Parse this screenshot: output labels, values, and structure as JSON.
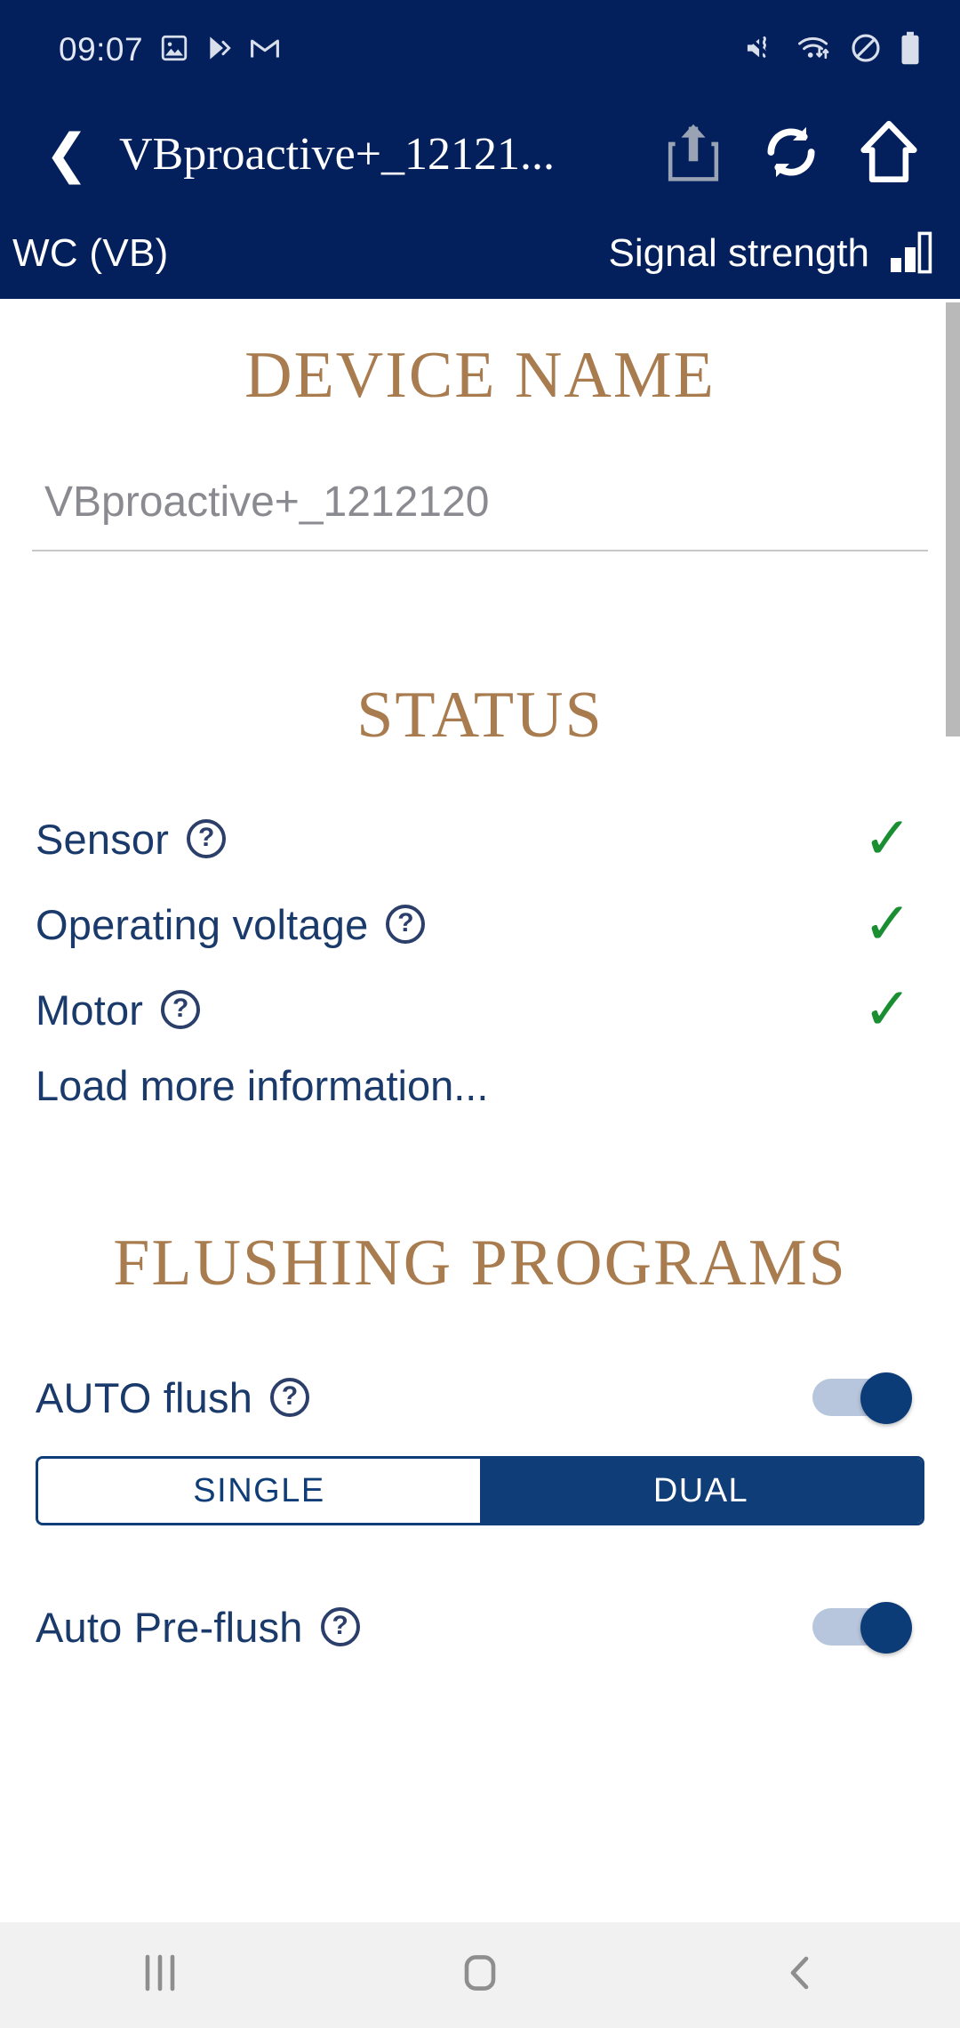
{
  "status_bar": {
    "time": "09:07",
    "left_icons": [
      "image-icon",
      "play-store-icon",
      "gmail-icon"
    ],
    "right_icons": [
      "mute-vibrate-icon",
      "wifi-icon",
      "do-not-disturb-icon",
      "battery-icon"
    ]
  },
  "toolbar": {
    "back_icon": "back-chevron-icon",
    "title": "VBproactive+_12121...",
    "actions": [
      "upload-icon",
      "sync-icon",
      "home-icon"
    ]
  },
  "subheader": {
    "left_label": "WC (VB)",
    "signal_label": "Signal strength",
    "signal_icon": "signal-bars-icon"
  },
  "device_name": {
    "section_title": "DEVICE NAME",
    "input_value": "VBproactive+_1212120",
    "input_placeholder": "VBproactive+_1212120"
  },
  "status": {
    "section_title": "STATUS",
    "items": [
      {
        "label": "Sensor",
        "help": "?",
        "state": "ok",
        "check": "✓"
      },
      {
        "label": "Operating voltage",
        "help": "?",
        "state": "ok",
        "check": "✓"
      },
      {
        "label": "Motor",
        "help": "?",
        "state": "ok",
        "check": "✓"
      }
    ],
    "load_more_label": "Load more information..."
  },
  "flushing_programs": {
    "section_title": "FLUSHING PROGRAMS",
    "auto_flush": {
      "label": "AUTO flush",
      "help": "?",
      "toggle_on": true,
      "segmented": {
        "options": [
          "SINGLE",
          "DUAL"
        ],
        "selected": "DUAL"
      }
    },
    "auto_preflush": {
      "label": "Auto Pre-flush",
      "help": "?",
      "toggle_on": true
    }
  },
  "nav_bar": {
    "recents_icon": "recents-icon",
    "home_icon": "home-square-icon",
    "back_icon": "back-chevron-icon"
  },
  "colors": {
    "navy": "#04205C",
    "accent_gold": "#A87C4F",
    "link_navy": "#1A3A6B",
    "check_green": "#1A8F32",
    "segment_navy": "#0E3D77"
  }
}
